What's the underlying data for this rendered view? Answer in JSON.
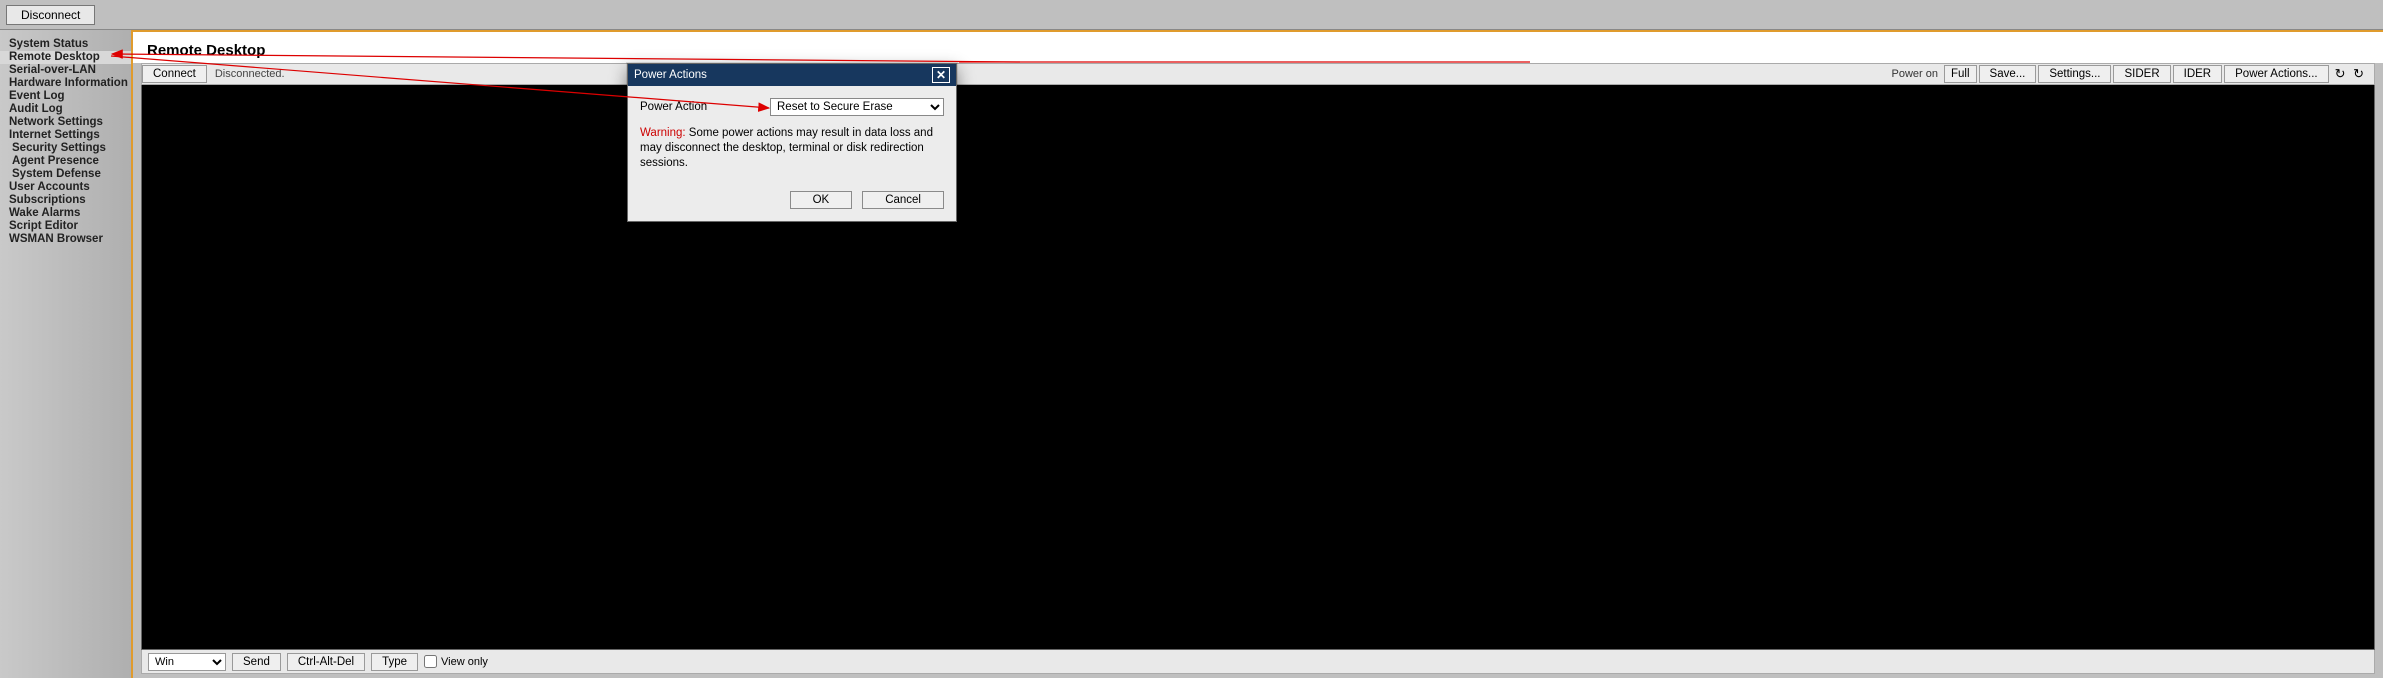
{
  "topbar": {
    "disconnect": "Disconnect"
  },
  "sidebar": {
    "items": [
      {
        "label": "System Status",
        "indent": false
      },
      {
        "label": "Remote Desktop",
        "indent": false,
        "active": true
      },
      {
        "label": "Serial-over-LAN",
        "indent": false
      },
      {
        "label": "Hardware Information",
        "indent": false
      },
      {
        "label": "Event Log",
        "indent": false
      },
      {
        "label": "Audit Log",
        "indent": false
      },
      {
        "label": "Network Settings",
        "indent": false
      },
      {
        "label": "Internet Settings",
        "indent": false
      },
      {
        "label": "Security Settings",
        "indent": true
      },
      {
        "label": "Agent Presence",
        "indent": true
      },
      {
        "label": "System Defense",
        "indent": true
      },
      {
        "label": "User Accounts",
        "indent": false
      },
      {
        "label": "Subscriptions",
        "indent": false
      },
      {
        "label": "Wake Alarms",
        "indent": false
      },
      {
        "label": "Script Editor",
        "indent": false
      },
      {
        "label": "WSMAN Browser",
        "indent": false
      }
    ]
  },
  "page": {
    "title": "Remote Desktop"
  },
  "toolbar": {
    "connect": "Connect",
    "status": "Disconnected.",
    "power_label": "Power on",
    "full": "Full",
    "save": "Save...",
    "settings": "Settings...",
    "sider": "SIDER",
    "ider": "IDER",
    "power_actions": "Power Actions...",
    "refresh": "↻ ↻"
  },
  "footer": {
    "os_select": "Win",
    "send": "Send",
    "cad": "Ctrl-Alt-Del",
    "type": "Type",
    "view_only": "View only"
  },
  "dialog": {
    "title": "Power Actions",
    "field_label": "Power Action",
    "selected": "Reset to Secure Erase",
    "warn_label": "Warning:",
    "warn_text": "Some power actions may result in data loss and may disconnect the desktop, terminal or disk redirection sessions.",
    "ok": "OK",
    "cancel": "Cancel"
  }
}
